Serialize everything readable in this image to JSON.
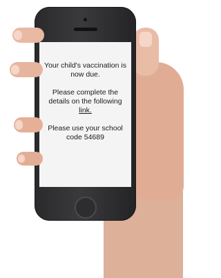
{
  "message": {
    "line1": "Your child's vaccination is now due.",
    "line2_prefix": "Please complete the details on the following",
    "link_label": "link.",
    "line3": "Please use your school code 54689"
  },
  "colors": {
    "skin": "#e4b39c",
    "phone_body": "#2a2a2c",
    "screen_bg": "#f4f4f4",
    "text": "#1a1a1a"
  }
}
